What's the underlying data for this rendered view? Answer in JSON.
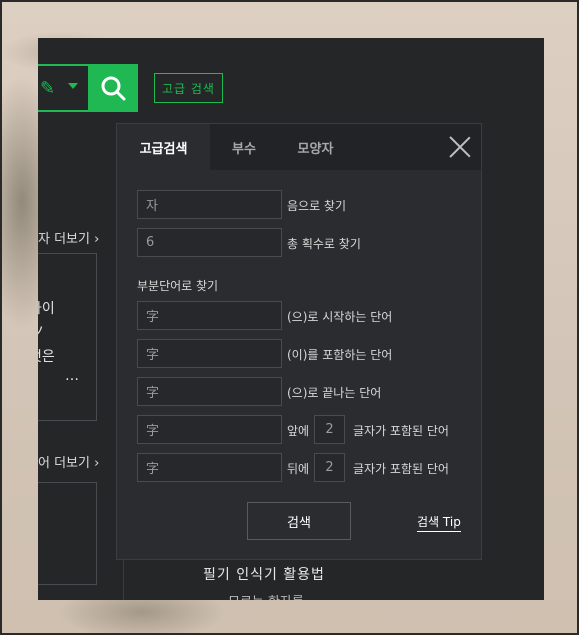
{
  "header": {
    "advanced_search_link": "고급 검색",
    "icons": [
      "pen-icon",
      "caret-down-icon",
      "search-icon"
    ],
    "accent_color": "#1fb853"
  },
  "background": {
    "more_link_1": "자 더보기 ›",
    "more_link_2": "어 더보기 ›",
    "card_lines": [
      "자이",
      "ノ",
      "첫은",
      "…"
    ],
    "bottom_line_1": "필기 인식기 활용법",
    "bottom_line_2": "모르는 한자를"
  },
  "modal": {
    "tabs": [
      "고급검색",
      "부수",
      "모양자"
    ],
    "active_tab": "고급검색",
    "by_sound": {
      "value": "자",
      "label": "음으로 찾기"
    },
    "by_strokes": {
      "value": "6",
      "label": "총 획수로 찾기"
    },
    "partial_title": "부분단어로 찾기",
    "partial_rows": [
      {
        "value": "字",
        "label": "(으)로 시작하는 단어"
      },
      {
        "value": "字",
        "label": "(이)를 포함하는 단어"
      },
      {
        "value": "字",
        "label": "(으)로 끝나는 단어"
      }
    ],
    "front_row": {
      "value": "字",
      "prefix": "앞에",
      "count": "2",
      "suffix": "글자가 포함된 단어"
    },
    "back_row": {
      "value": "字",
      "prefix": "뒤에",
      "count": "2",
      "suffix": "글자가 포함된 단어"
    },
    "search_button": "검색",
    "tip_link": "검색 Tip"
  }
}
